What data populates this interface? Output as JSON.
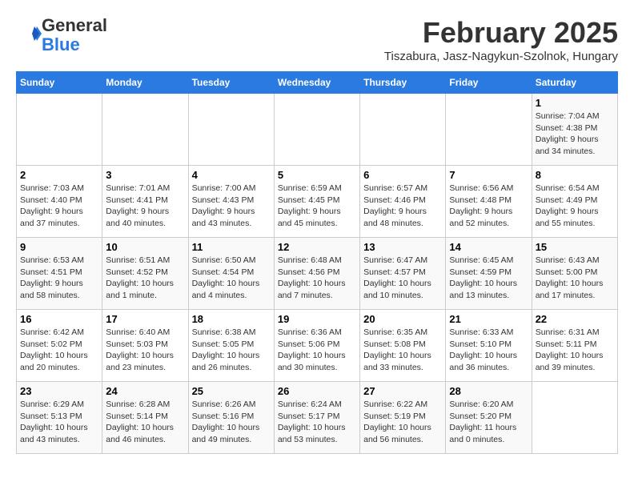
{
  "logo": {
    "general": "General",
    "blue": "Blue"
  },
  "title": "February 2025",
  "location": "Tiszabura, Jasz-Nagykun-Szolnok, Hungary",
  "days_of_week": [
    "Sunday",
    "Monday",
    "Tuesday",
    "Wednesday",
    "Thursday",
    "Friday",
    "Saturday"
  ],
  "weeks": [
    [
      {
        "day": "",
        "info": ""
      },
      {
        "day": "",
        "info": ""
      },
      {
        "day": "",
        "info": ""
      },
      {
        "day": "",
        "info": ""
      },
      {
        "day": "",
        "info": ""
      },
      {
        "day": "",
        "info": ""
      },
      {
        "day": "1",
        "info": "Sunrise: 7:04 AM\nSunset: 4:38 PM\nDaylight: 9 hours and 34 minutes."
      }
    ],
    [
      {
        "day": "2",
        "info": "Sunrise: 7:03 AM\nSunset: 4:40 PM\nDaylight: 9 hours and 37 minutes."
      },
      {
        "day": "3",
        "info": "Sunrise: 7:01 AM\nSunset: 4:41 PM\nDaylight: 9 hours and 40 minutes."
      },
      {
        "day": "4",
        "info": "Sunrise: 7:00 AM\nSunset: 4:43 PM\nDaylight: 9 hours and 43 minutes."
      },
      {
        "day": "5",
        "info": "Sunrise: 6:59 AM\nSunset: 4:45 PM\nDaylight: 9 hours and 45 minutes."
      },
      {
        "day": "6",
        "info": "Sunrise: 6:57 AM\nSunset: 4:46 PM\nDaylight: 9 hours and 48 minutes."
      },
      {
        "day": "7",
        "info": "Sunrise: 6:56 AM\nSunset: 4:48 PM\nDaylight: 9 hours and 52 minutes."
      },
      {
        "day": "8",
        "info": "Sunrise: 6:54 AM\nSunset: 4:49 PM\nDaylight: 9 hours and 55 minutes."
      }
    ],
    [
      {
        "day": "9",
        "info": "Sunrise: 6:53 AM\nSunset: 4:51 PM\nDaylight: 9 hours and 58 minutes."
      },
      {
        "day": "10",
        "info": "Sunrise: 6:51 AM\nSunset: 4:52 PM\nDaylight: 10 hours and 1 minute."
      },
      {
        "day": "11",
        "info": "Sunrise: 6:50 AM\nSunset: 4:54 PM\nDaylight: 10 hours and 4 minutes."
      },
      {
        "day": "12",
        "info": "Sunrise: 6:48 AM\nSunset: 4:56 PM\nDaylight: 10 hours and 7 minutes."
      },
      {
        "day": "13",
        "info": "Sunrise: 6:47 AM\nSunset: 4:57 PM\nDaylight: 10 hours and 10 minutes."
      },
      {
        "day": "14",
        "info": "Sunrise: 6:45 AM\nSunset: 4:59 PM\nDaylight: 10 hours and 13 minutes."
      },
      {
        "day": "15",
        "info": "Sunrise: 6:43 AM\nSunset: 5:00 PM\nDaylight: 10 hours and 17 minutes."
      }
    ],
    [
      {
        "day": "16",
        "info": "Sunrise: 6:42 AM\nSunset: 5:02 PM\nDaylight: 10 hours and 20 minutes."
      },
      {
        "day": "17",
        "info": "Sunrise: 6:40 AM\nSunset: 5:03 PM\nDaylight: 10 hours and 23 minutes."
      },
      {
        "day": "18",
        "info": "Sunrise: 6:38 AM\nSunset: 5:05 PM\nDaylight: 10 hours and 26 minutes."
      },
      {
        "day": "19",
        "info": "Sunrise: 6:36 AM\nSunset: 5:06 PM\nDaylight: 10 hours and 30 minutes."
      },
      {
        "day": "20",
        "info": "Sunrise: 6:35 AM\nSunset: 5:08 PM\nDaylight: 10 hours and 33 minutes."
      },
      {
        "day": "21",
        "info": "Sunrise: 6:33 AM\nSunset: 5:10 PM\nDaylight: 10 hours and 36 minutes."
      },
      {
        "day": "22",
        "info": "Sunrise: 6:31 AM\nSunset: 5:11 PM\nDaylight: 10 hours and 39 minutes."
      }
    ],
    [
      {
        "day": "23",
        "info": "Sunrise: 6:29 AM\nSunset: 5:13 PM\nDaylight: 10 hours and 43 minutes."
      },
      {
        "day": "24",
        "info": "Sunrise: 6:28 AM\nSunset: 5:14 PM\nDaylight: 10 hours and 46 minutes."
      },
      {
        "day": "25",
        "info": "Sunrise: 6:26 AM\nSunset: 5:16 PM\nDaylight: 10 hours and 49 minutes."
      },
      {
        "day": "26",
        "info": "Sunrise: 6:24 AM\nSunset: 5:17 PM\nDaylight: 10 hours and 53 minutes."
      },
      {
        "day": "27",
        "info": "Sunrise: 6:22 AM\nSunset: 5:19 PM\nDaylight: 10 hours and 56 minutes."
      },
      {
        "day": "28",
        "info": "Sunrise: 6:20 AM\nSunset: 5:20 PM\nDaylight: 11 hours and 0 minutes."
      },
      {
        "day": "",
        "info": ""
      }
    ]
  ]
}
